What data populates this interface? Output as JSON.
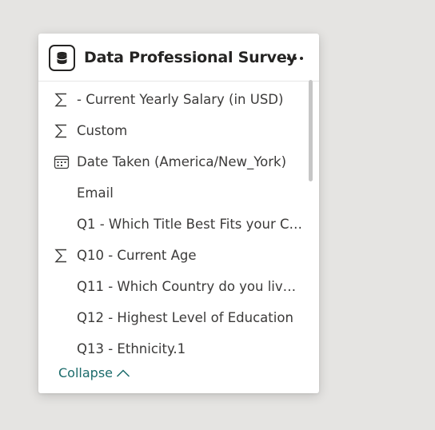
{
  "card": {
    "title": "Data Professional Survey",
    "header_icon": "database-icon",
    "more_icon": "more-options-icon",
    "fields": [
      {
        "label": "- Current Yearly Salary (in USD)",
        "icon": "sigma-icon"
      },
      {
        "label": "Custom",
        "icon": "sigma-icon"
      },
      {
        "label": "Date Taken (America/New_York)",
        "icon": "calendar-icon"
      },
      {
        "label": "Email",
        "icon": ""
      },
      {
        "label": "Q1 - Which Title Best Fits your Cu...",
        "icon": ""
      },
      {
        "label": "Q10 - Current Age",
        "icon": "sigma-icon"
      },
      {
        "label": "Q11 - Which Country do you live ...",
        "icon": ""
      },
      {
        "label": "Q12 - Highest Level of Education",
        "icon": ""
      },
      {
        "label": "Q13 - Ethnicity.1",
        "icon": ""
      }
    ],
    "collapse_label": "Collapse",
    "collapse_icon": "chevron-up-icon"
  },
  "colors": {
    "background": "#e5e4e2",
    "card": "#ffffff",
    "text": "#3b3a39",
    "title": "#252423",
    "accent": "#1b6b6b"
  }
}
